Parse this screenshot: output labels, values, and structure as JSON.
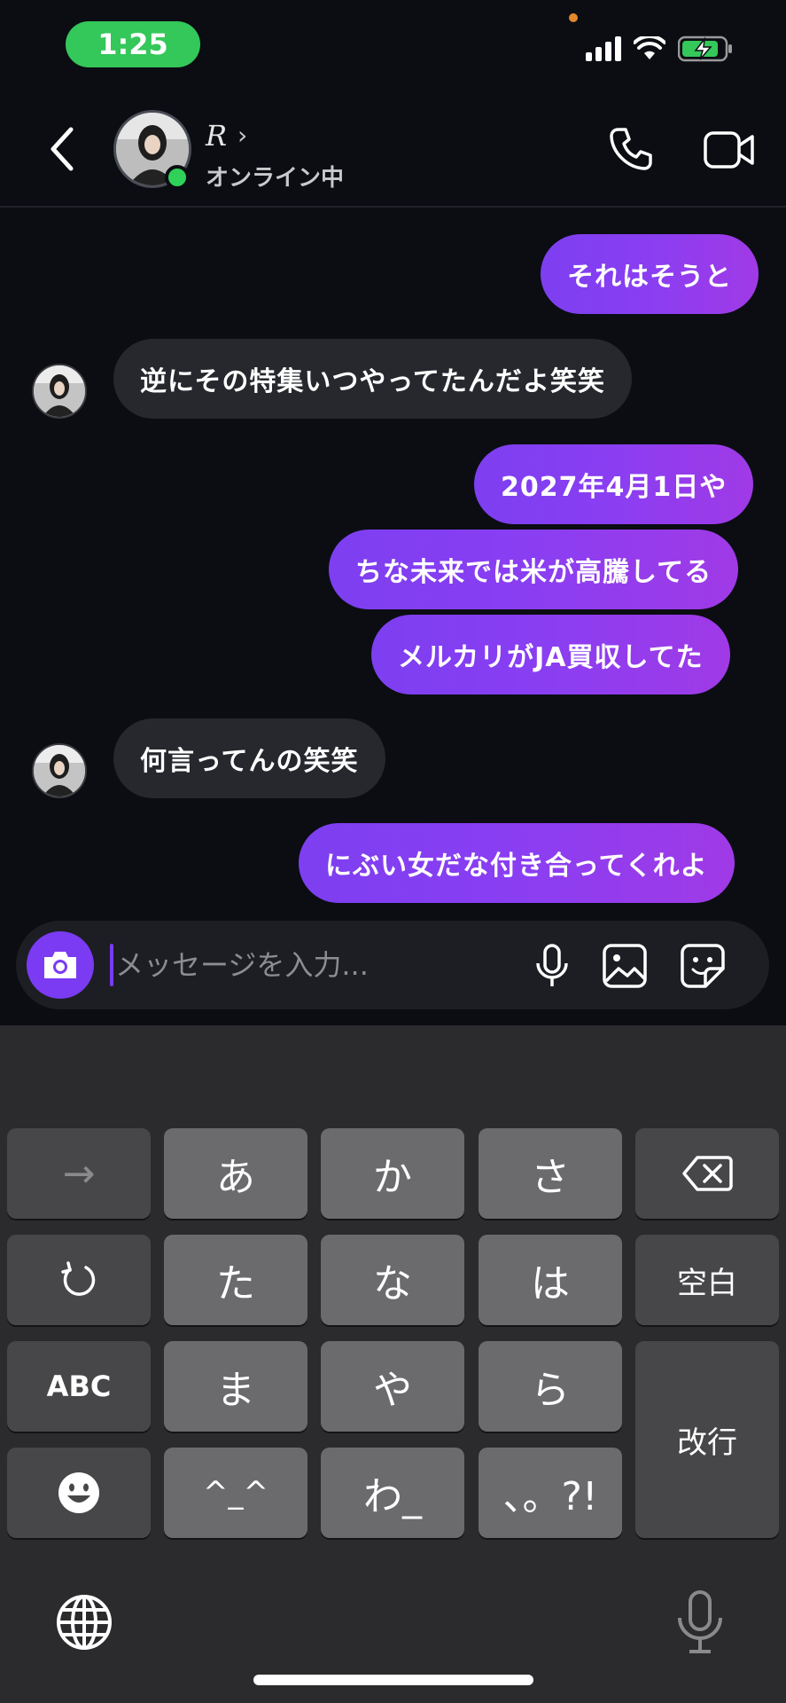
{
  "status_bar": {
    "time": "1:25"
  },
  "header": {
    "contact_name": "R",
    "name_chevron": "›",
    "status": "オンライン中"
  },
  "messages": [
    {
      "text": "それはそうと",
      "direction": "out"
    },
    {
      "text": "逆にその特集いつやってたんだよ笑笑",
      "direction": "in"
    },
    {
      "text": "2027年4月1日や",
      "direction": "out"
    },
    {
      "text": "ちな未来では米が高騰してる",
      "direction": "out"
    },
    {
      "text": "メルカリがJA買収してた",
      "direction": "out"
    },
    {
      "text": "何言ってんの笑笑",
      "direction": "in"
    },
    {
      "text": "にぶい女だな付き合ってくれよ",
      "direction": "out"
    }
  ],
  "composer": {
    "placeholder": "メッセージを入力...",
    "value": ""
  },
  "keyboard": {
    "keys": {
      "arrow": "→",
      "a": "あ",
      "ka": "か",
      "sa": "さ",
      "ta": "た",
      "na": "な",
      "ha": "は",
      "space": "空白",
      "abc": "ABC",
      "ma": "ま",
      "ya": "や",
      "ra": "ら",
      "enter": "改行",
      "kaomoji": "^_^",
      "wa": "わ_",
      "punct": "、。?!"
    }
  },
  "colors": {
    "accent": "#7a3bf2",
    "online": "#2fd158",
    "time_pill": "#34c759"
  },
  "icons": [
    "back-chevron-icon",
    "phone-icon",
    "video-camera-icon",
    "camera-icon",
    "microphone-icon",
    "image-icon",
    "sticker-icon",
    "backspace-icon",
    "undo-icon",
    "emoji-icon",
    "globe-icon",
    "dictation-icon"
  ]
}
